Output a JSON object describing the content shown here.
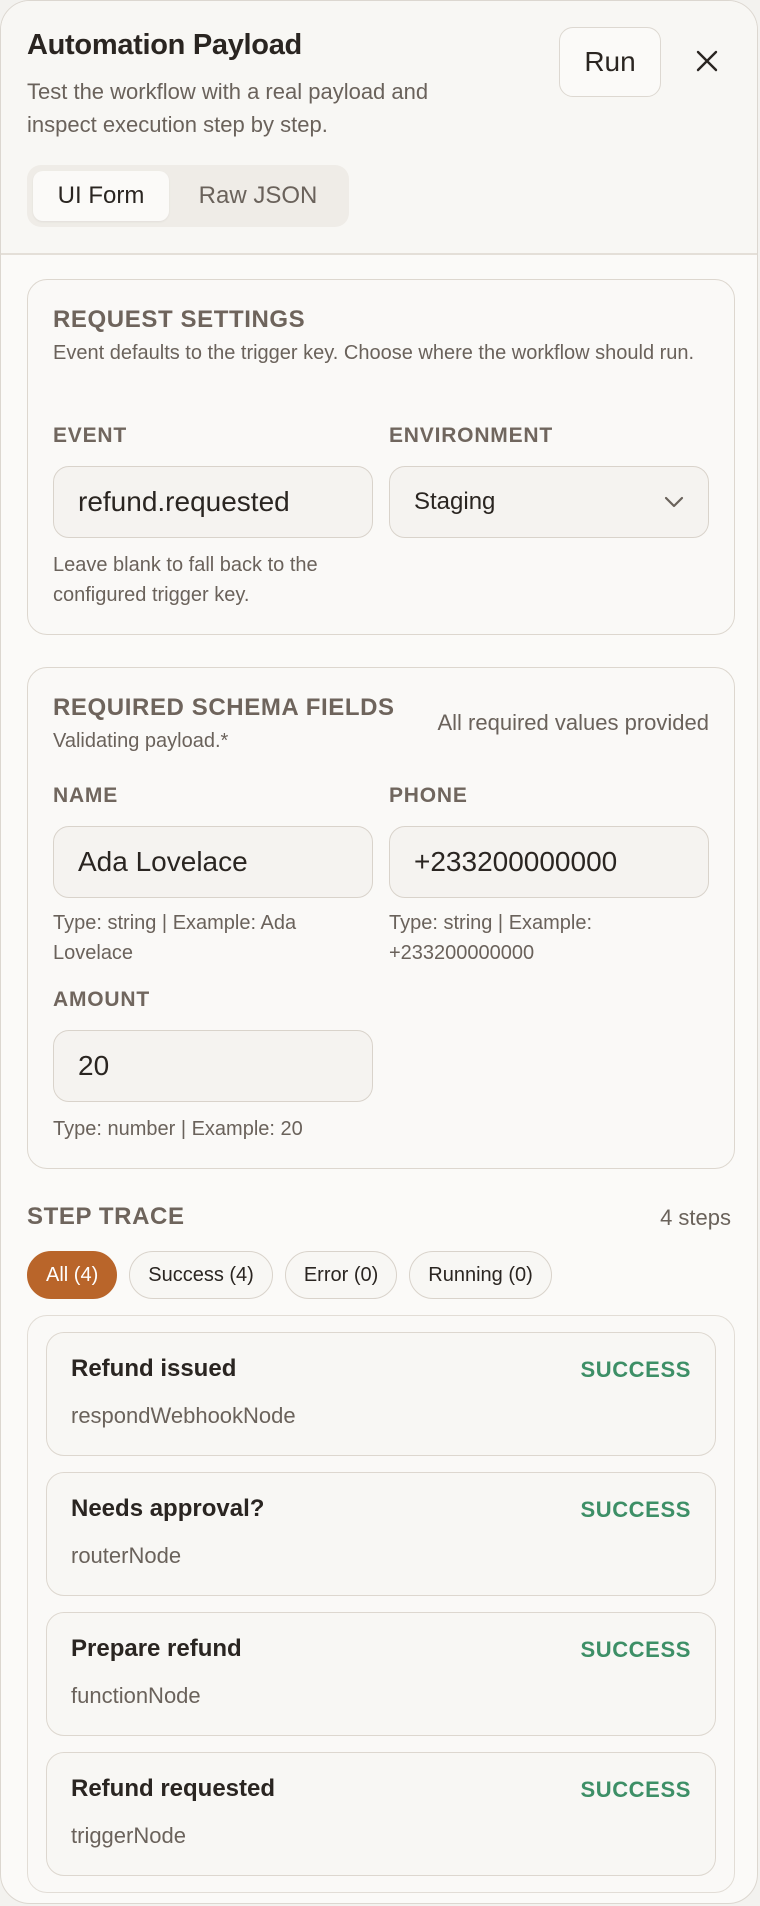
{
  "header": {
    "title": "Automation Payload",
    "subtitle": "Test the workflow with a real payload and inspect execution step by step.",
    "run_label": "Run",
    "tabs": [
      {
        "label": "UI Form",
        "active": true
      },
      {
        "label": "Raw JSON",
        "active": false
      }
    ]
  },
  "request_settings": {
    "title": "REQUEST SETTINGS",
    "description": "Event defaults to the trigger key. Choose where the workflow should run.",
    "event_label": "EVENT",
    "event_value": "refund.requested",
    "event_hint": "Leave blank to fall back to the configured trigger key.",
    "environment_label": "ENVIRONMENT",
    "environment_value": "Staging"
  },
  "schema_fields": {
    "title": "REQUIRED SCHEMA FIELDS",
    "subtitle": "Validating payload.*",
    "status": "All required values provided",
    "name": {
      "label": "NAME",
      "value": "Ada Lovelace",
      "hint": "Type: string | Example: Ada Lovelace"
    },
    "phone": {
      "label": "PHONE",
      "value": "+233200000000",
      "hint": "Type: string | Example: +233200000000"
    },
    "amount": {
      "label": "AMOUNT",
      "value": "20",
      "hint": "Type: number | Example: 20"
    }
  },
  "trace": {
    "title": "STEP TRACE",
    "count": "4 steps",
    "filters": [
      {
        "label": "All (4)",
        "active": true
      },
      {
        "label": "Success (4)",
        "active": false
      },
      {
        "label": "Error (0)",
        "active": false
      },
      {
        "label": "Running (0)",
        "active": false
      }
    ],
    "steps": [
      {
        "name": "Refund issued",
        "node": "respondWebhookNode",
        "status": "SUCCESS"
      },
      {
        "name": "Needs approval?",
        "node": "routerNode",
        "status": "SUCCESS"
      },
      {
        "name": "Prepare refund",
        "node": "functionNode",
        "status": "SUCCESS"
      },
      {
        "name": "Refund requested",
        "node": "triggerNode",
        "status": "SUCCESS"
      }
    ]
  },
  "colors": {
    "accent": "#b9652a",
    "success": "#3d8f66"
  }
}
